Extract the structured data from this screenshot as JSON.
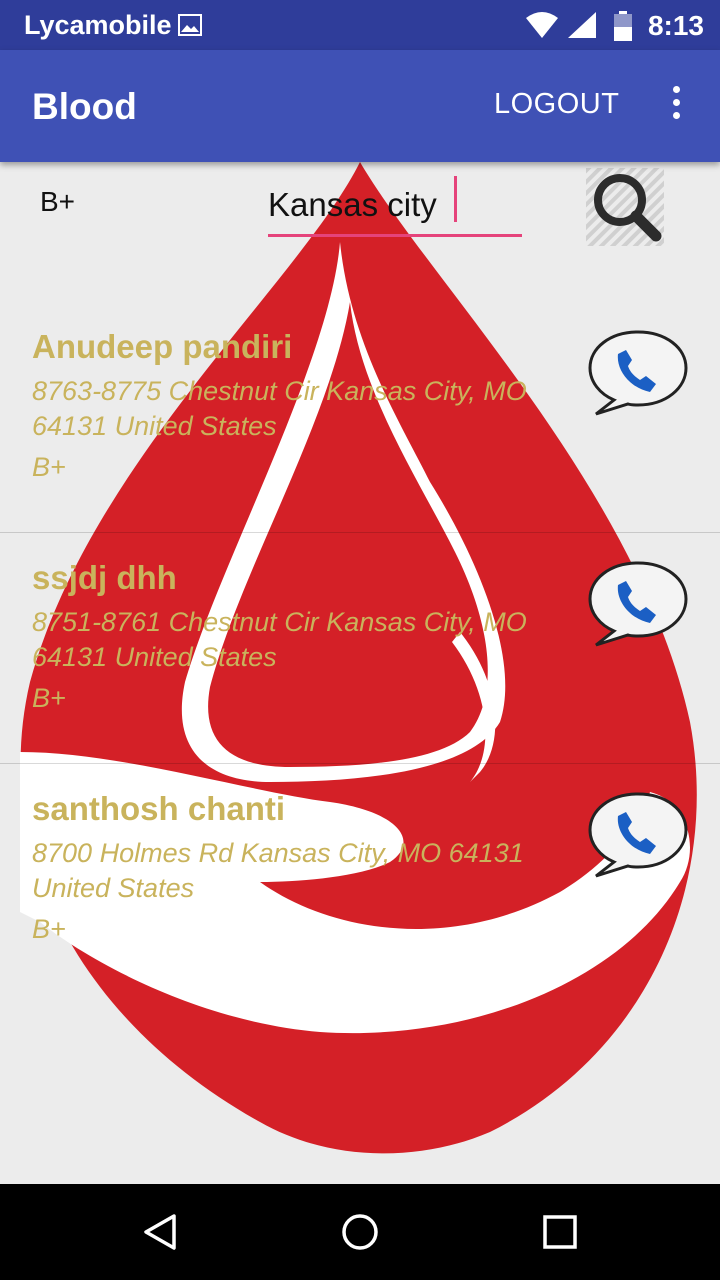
{
  "status_bar": {
    "carrier": "Lycamobile",
    "time": "8:13",
    "icons": [
      "image-notification-icon",
      "wifi-icon",
      "signal-icon",
      "battery-icon"
    ]
  },
  "app_bar": {
    "title": "Blood",
    "logout_label": "LOGOUT",
    "overflow_icon": "more-vert-icon",
    "color": "#3f51b5"
  },
  "search": {
    "blood_group": "B+",
    "city_value": "Kansas city",
    "search_icon": "search-icon",
    "underline_color": "#e5437b"
  },
  "donors": [
    {
      "name": "Anudeep pandiri",
      "address": "8763-8775 Chestnut Cir  Kansas City, MO 64131  United States",
      "blood_group": "B+"
    },
    {
      "name": "ssjdj dhh",
      "address": "8751-8761 Chestnut Cir  Kansas City, MO 64131  United States",
      "blood_group": "B+"
    },
    {
      "name": "santhosh chanti",
      "address": "8700 Holmes Rd Kansas City, MO 64131 United States",
      "blood_group": "B+"
    }
  ],
  "nav_bar": {
    "icons": [
      "back-icon",
      "home-icon",
      "recents-icon"
    ]
  },
  "colors": {
    "status_bar": "#2f3d9a",
    "text_gold": "#c9b35c",
    "drop_red": "#d42027"
  }
}
